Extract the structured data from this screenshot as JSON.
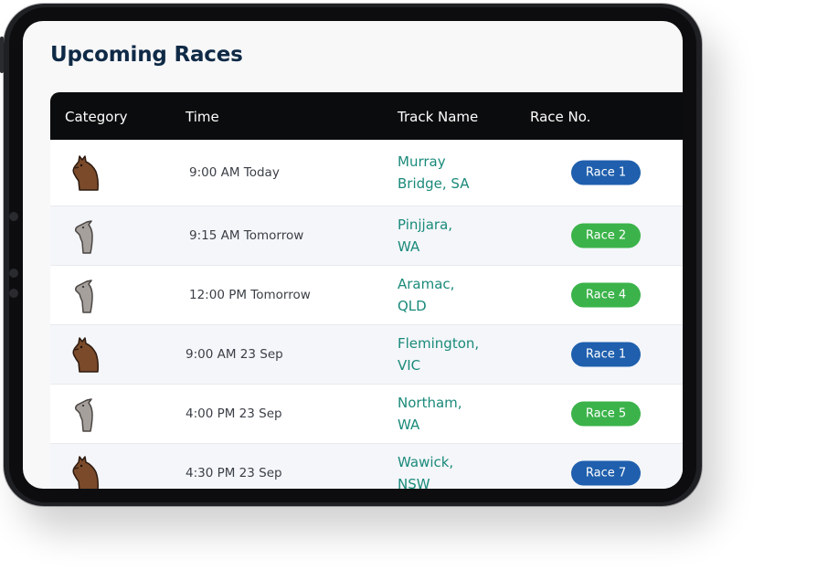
{
  "page": {
    "title": "Upcoming Races"
  },
  "table": {
    "headers": {
      "category": "Category",
      "time": "Time",
      "track": "Track Name",
      "race": "Race No."
    },
    "rows": [
      {
        "category": "horse-icon",
        "time": "9:00 AM Today",
        "track": "Murray Bridge, SA",
        "race": "Race 1",
        "race_color": "#1f5fad"
      },
      {
        "category": "greyhound-icon",
        "time": "9:15 AM Tomorrow",
        "track": "Pinjjara, WA",
        "race": "Race 2",
        "race_color": "#3bb34a"
      },
      {
        "category": "greyhound-icon",
        "time": "12:00 PM Tomorrow",
        "track": "Aramac, QLD",
        "race": "Race 4",
        "race_color": "#3bb34a"
      },
      {
        "category": "horse-icon",
        "time": "9:00 AM 23 Sep",
        "track": "Flemington, VIC",
        "race": "Race 1",
        "race_color": "#1f5fad"
      },
      {
        "category": "greyhound-icon",
        "time": "4:00 PM 23 Sep",
        "track": "Northam, WA",
        "race": "Race 5",
        "race_color": "#3bb34a"
      },
      {
        "category": "horse-icon",
        "time": "4:30 PM 23 Sep",
        "track": "Wawick, NSW",
        "race": "Race 7",
        "race_color": "#1f5fad"
      }
    ]
  },
  "colors": {
    "header_bg": "#0b0c0d",
    "title": "#0f2a46",
    "track_text": "#1a8a7a"
  }
}
